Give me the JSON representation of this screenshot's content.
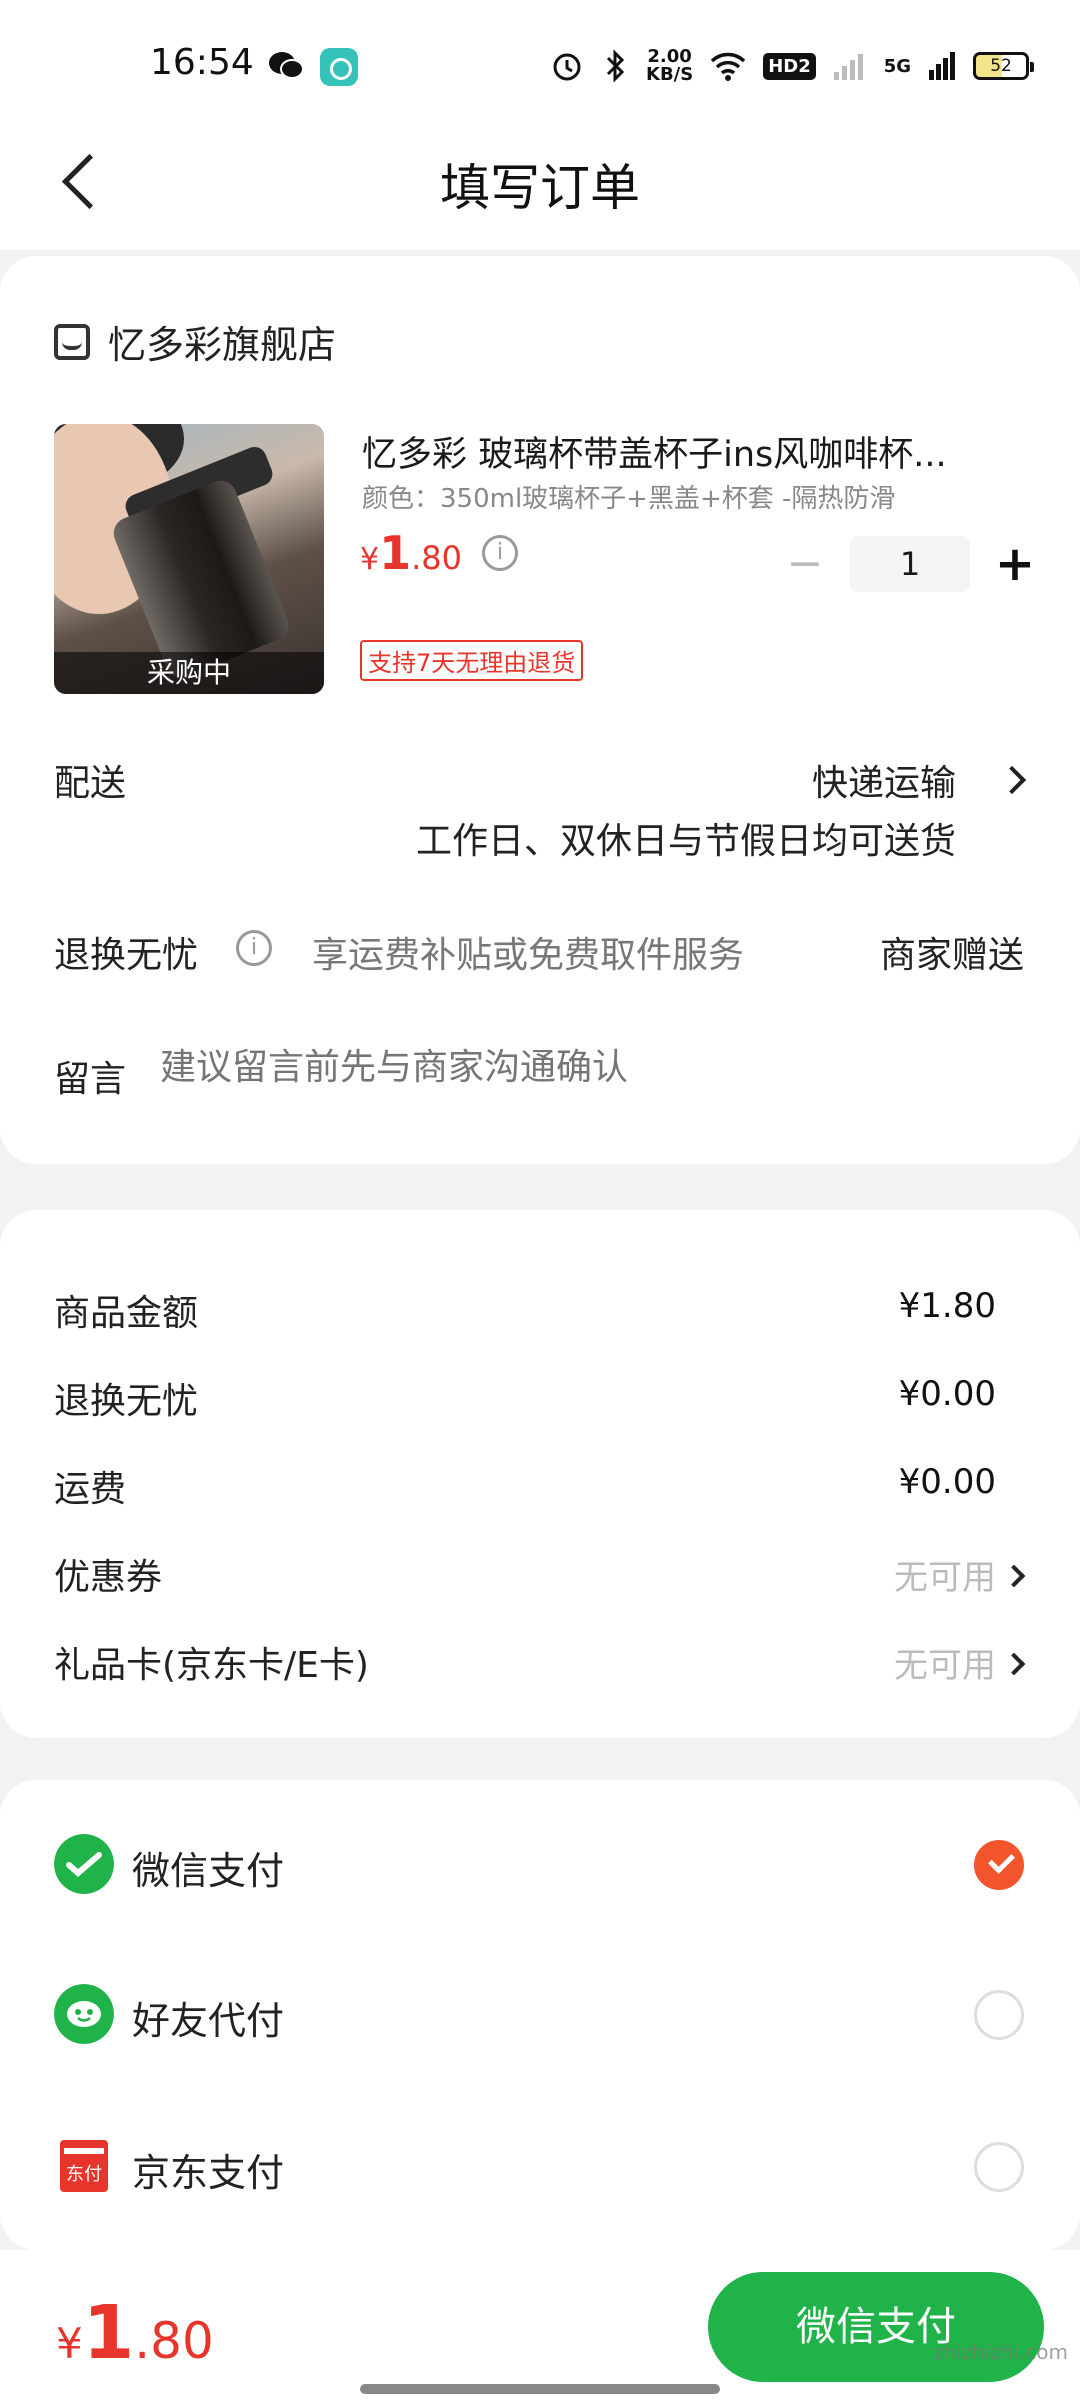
{
  "status_bar": {
    "time": "16:54",
    "net_speed_value": "2.00",
    "net_speed_unit": "KB/S",
    "hd_label": "HD2",
    "net_type": "5G",
    "battery": "52",
    "icons": [
      "wechat-icon",
      "app-icon",
      "alarm-icon",
      "bluetooth-icon",
      "wifi-icon",
      "signal-icon"
    ]
  },
  "header": {
    "title": "填写订单"
  },
  "store": {
    "name": "忆多彩旗舰店"
  },
  "product": {
    "title": "忆多彩 玻璃杯带盖杯子ins风咖啡杯...",
    "spec": "颜色：350ml玻璃杯子+黑盖+杯套 -隔热防滑",
    "price_symbol": "¥",
    "price_int": "1",
    "price_dec": ".80",
    "quantity": "1",
    "return_tag": "支持7天无理由退货",
    "image_tag": "采购中"
  },
  "delivery": {
    "label": "配送",
    "method": "快递运输",
    "note": "工作日、双休日与节假日均可送货"
  },
  "return_service": {
    "label": "退换无忧",
    "desc": "享运费补贴或免费取件服务",
    "value": "商家赠送"
  },
  "message": {
    "label": "留言",
    "placeholder": "建议留言前先与商家沟通确认"
  },
  "amounts": {
    "goods_label": "商品金额",
    "goods_value": "¥1.80",
    "return_label": "退换无忧",
    "return_value": "¥0.00",
    "shipping_label": "运费",
    "shipping_value": "¥0.00",
    "coupon_label": "优惠券",
    "coupon_value": "无可用",
    "giftcard_label": "礼品卡(京东卡/E卡)",
    "giftcard_value": "无可用"
  },
  "payment": {
    "methods": [
      {
        "label": "微信支付",
        "selected": true,
        "color": "#1fb34a"
      },
      {
        "label": "好友代付",
        "selected": false,
        "color": "#1fb34a"
      },
      {
        "label": "京东支付",
        "selected": false,
        "color": "#e8352b"
      }
    ],
    "jd_icon_text": "东付"
  },
  "footer": {
    "total_symbol": "¥",
    "total_int": "1",
    "total_dec": ".80",
    "pay_button": "微信支付",
    "watermark": "zhizhizhi.com"
  },
  "colors": {
    "accent_red": "#e8352b",
    "wechat_green": "#1fb34a",
    "radio_selected": "#f2552c"
  }
}
